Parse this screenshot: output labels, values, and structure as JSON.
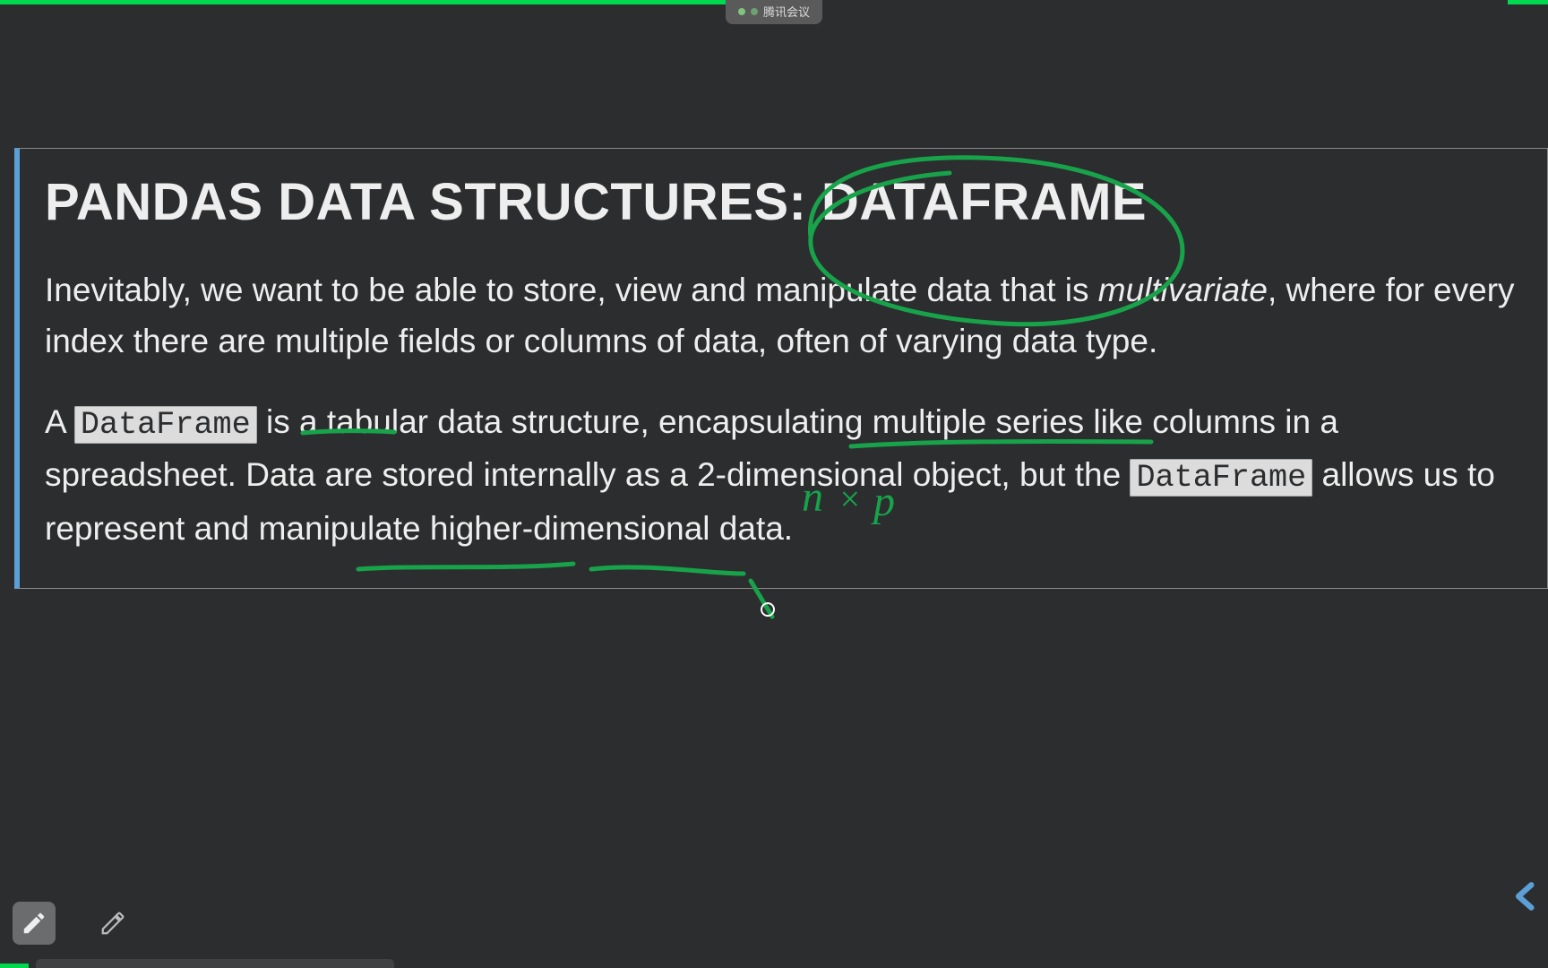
{
  "meeting_bar": {
    "label": "腾讯会议"
  },
  "slide": {
    "heading": "PANDAS DATA STRUCTURES: DATAFRAME",
    "para1_pre": "Inevitably, we want to be able to store, view and manipulate data that is ",
    "para1_em": "multivariate",
    "para1_post": ", where for every index there are multiple fields or columns of data, often of varying data type.",
    "para2_a": "A ",
    "para2_code1": "DataFrame",
    "para2_b": " is a tabular data structure, encapsulating multiple series like columns in a spreadsheet. Data are stored internally as a 2-dimensional object, but the ",
    "para2_code2": "DataFrame",
    "para2_c": " allows us to represent and manipulate higher-dimensional data."
  },
  "annotation_markup": "n × p",
  "icons": {
    "edit_filled": "pencil-icon",
    "edit_outline": "pencil-icon",
    "nav_next": "chevron-left-icon"
  }
}
